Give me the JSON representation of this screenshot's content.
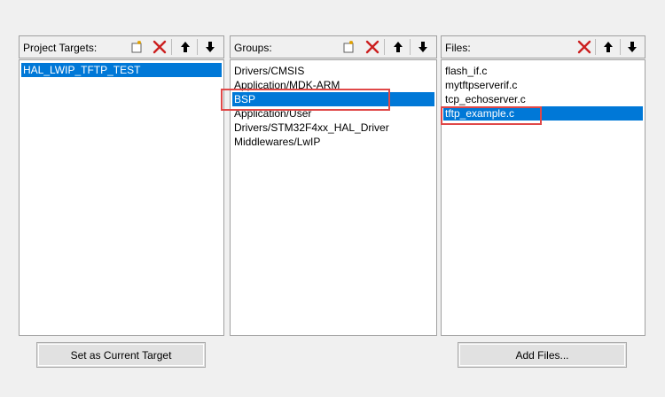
{
  "targets_panel": {
    "label": "Project Targets:",
    "items": [
      "HAL_LWIP_TFTP_TEST"
    ],
    "selected_index": 0
  },
  "groups_panel": {
    "label": "Groups:",
    "items": [
      "Drivers/CMSIS",
      "Application/MDK-ARM",
      "BSP",
      "Application/User",
      "Drivers/STM32F4xx_HAL_Driver",
      "Middlewares/LwIP"
    ],
    "selected_index": 2,
    "highlighted_index": 2
  },
  "files_panel": {
    "label": "Files:",
    "items": [
      "flash_if.c",
      "mytftpserverif.c",
      "tcp_echoserver.c",
      "tftp_example.c"
    ],
    "selected_index": 3,
    "highlighted_index": 3
  },
  "buttons": {
    "set_current_target": "Set as Current Target",
    "add_files": "Add Files..."
  },
  "icons": {
    "new": "new-icon",
    "delete": "delete-icon",
    "move_up": "move-up-icon",
    "move_down": "move-down-icon"
  },
  "colors": {
    "selection": "#0078d7",
    "delete_red": "#cc1f1f",
    "highlight_box": "#e04848"
  }
}
